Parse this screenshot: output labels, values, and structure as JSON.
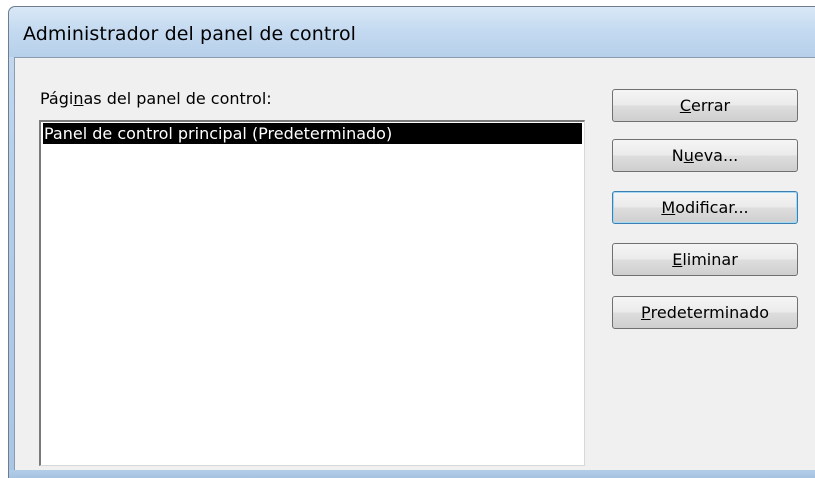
{
  "window": {
    "title": "Administrador del panel de control"
  },
  "list": {
    "label_pre": "Pági",
    "label_access": "n",
    "label_post": "as del panel de control:",
    "items": [
      {
        "label": "Panel de control principal (Predeterminado)",
        "selected": true
      }
    ]
  },
  "buttons": {
    "close": {
      "pre": "",
      "access": "C",
      "post": "errar"
    },
    "new": {
      "pre": "N",
      "access": "u",
      "post": "eva..."
    },
    "edit": {
      "pre": "",
      "access": "M",
      "post": "odificar..."
    },
    "delete": {
      "pre": "",
      "access": "E",
      "post": "liminar"
    },
    "default": {
      "pre": "",
      "access": "P",
      "post": "redeterminado"
    }
  },
  "colors": {
    "selection_bg": "#000000",
    "selection_fg": "#ffffff",
    "focus_border": "#3c7fb1"
  }
}
